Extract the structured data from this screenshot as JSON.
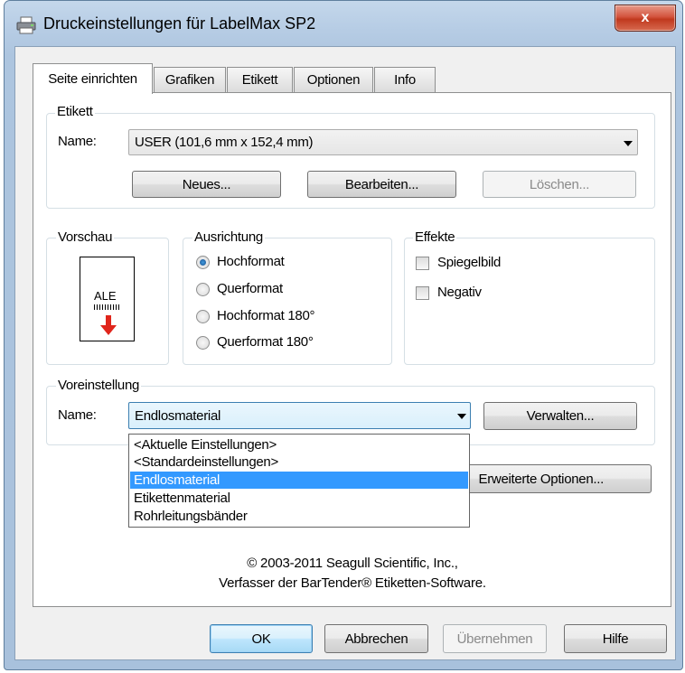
{
  "window": {
    "title": "Druckeinstellungen für LabelMax SP2",
    "close_glyph": "x"
  },
  "tabs": [
    {
      "label": "Seite einrichten"
    },
    {
      "label": "Grafiken"
    },
    {
      "label": "Etikett"
    },
    {
      "label": "Optionen"
    },
    {
      "label": "Info"
    }
  ],
  "etikett": {
    "legend": "Etikett",
    "name_label": "Name:",
    "name_value": "USER (101,6 mm x 152,4 mm)",
    "buttons": {
      "new": "Neues...",
      "edit": "Bearbeiten...",
      "delete": "Löschen..."
    }
  },
  "vorschau": {
    "legend": "Vorschau",
    "preview_text": "ALE"
  },
  "ausrichtung": {
    "legend": "Ausrichtung",
    "options": [
      "Hochformat",
      "Querformat",
      "Hochformat 180°",
      "Querformat 180°"
    ],
    "selected_index": 0
  },
  "effekte": {
    "legend": "Effekte",
    "options": [
      {
        "label": "Spiegelbild",
        "checked": false
      },
      {
        "label": "Negativ",
        "checked": false
      }
    ]
  },
  "voreinstellung": {
    "legend": "Voreinstellung",
    "name_label": "Name:",
    "name_value": "Endlosmaterial",
    "manage_button": "Verwalten...",
    "advanced_button": "Erweiterte Optionen...",
    "dropdown": [
      "<Aktuelle Einstellungen>",
      "<Standardeinstellungen>",
      "Endlosmaterial",
      "Etikettenmaterial",
      "Rohrleitungsbänder"
    ],
    "dropdown_selected_index": 2
  },
  "copyright": {
    "line1": "© 2003-2011 Seagull Scientific, Inc.,",
    "line2": "Verfasser der BarTender® Etiketten-Software."
  },
  "footer": {
    "ok": "OK",
    "cancel": "Abbrechen",
    "apply": "Übernehmen",
    "help": "Hilfe"
  },
  "colors": {
    "selection": "#3399ff",
    "close_button": "#c0391e",
    "title_bar": "#b7cde5"
  }
}
